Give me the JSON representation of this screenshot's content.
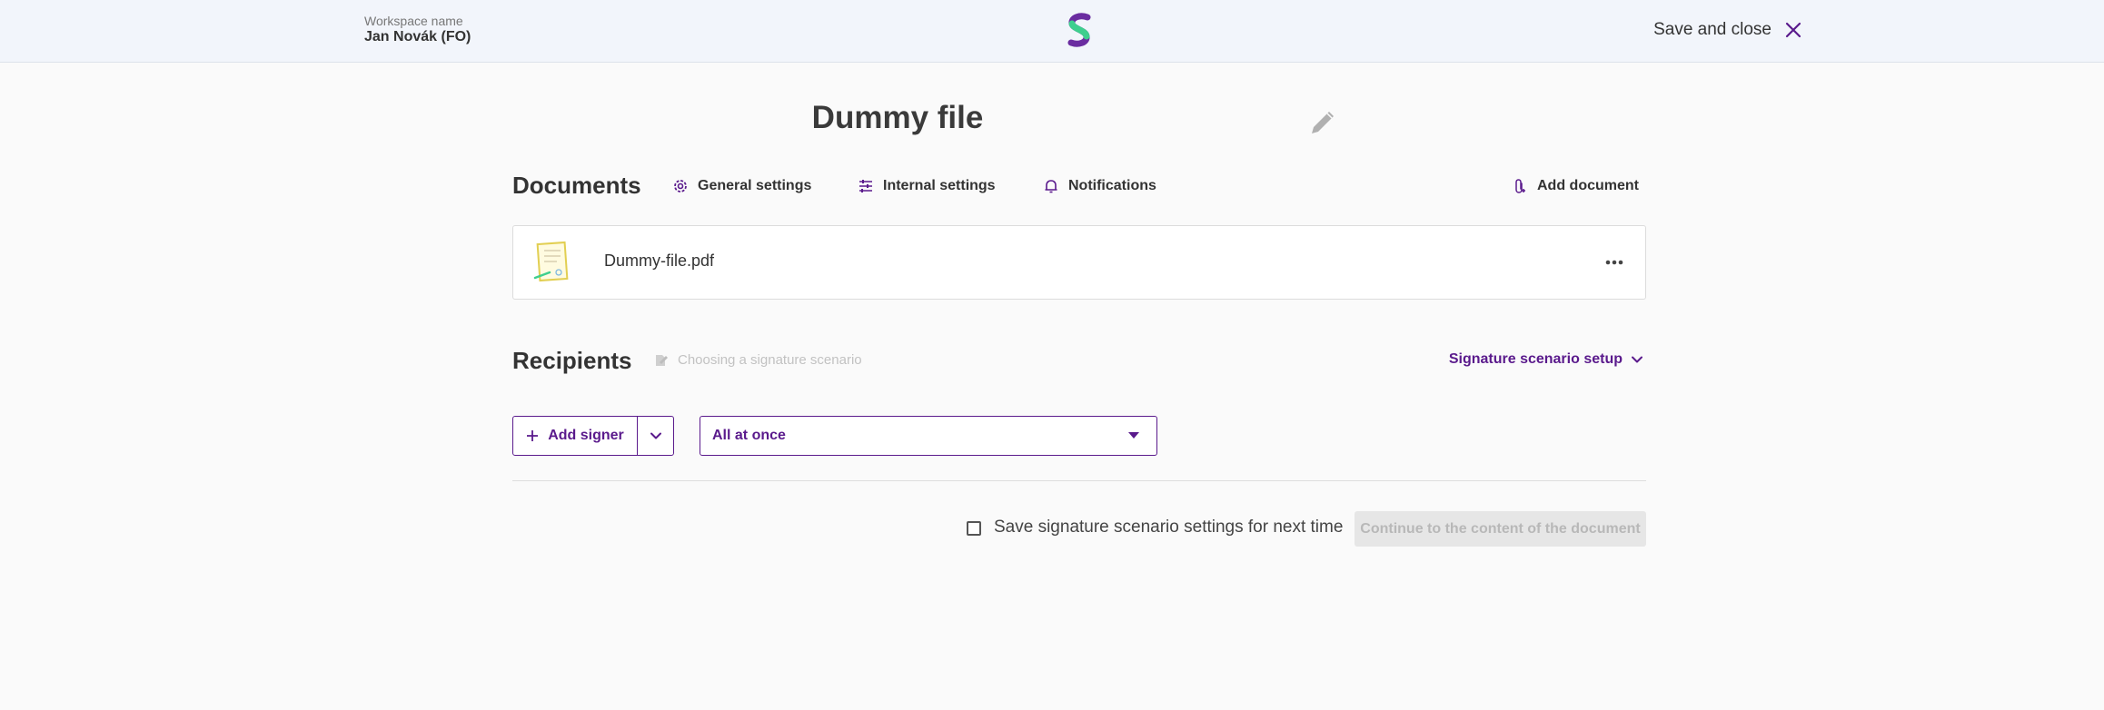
{
  "header": {
    "workspace_label": "Workspace name",
    "workspace_name": "Jan Novák (FO)",
    "save_close_label": "Save and close"
  },
  "title": "Dummy file",
  "documents": {
    "heading": "Documents",
    "tabs": [
      {
        "label": "General settings",
        "icon": "gear-icon"
      },
      {
        "label": "Internal settings",
        "icon": "sliders-icon"
      },
      {
        "label": "Notifications",
        "icon": "bell-icon"
      }
    ],
    "add_document_label": "Add document",
    "files": [
      {
        "name": "Dummy-file.pdf"
      }
    ]
  },
  "recipients": {
    "heading": "Recipients",
    "scenario_hint": "Choosing a signature scenario",
    "scenario_setup_label": "Signature scenario setup",
    "add_signer_label": "Add signer",
    "signing_order_selected": "All at once"
  },
  "footer": {
    "save_settings_label": "Save signature scenario settings for next time",
    "save_settings_checked": false,
    "continue_label": "Continue to the content of the document"
  },
  "colors": {
    "accent": "#5a1a8c",
    "logo_green": "#3ecf8e",
    "logo_purple": "#6a2ca0"
  }
}
